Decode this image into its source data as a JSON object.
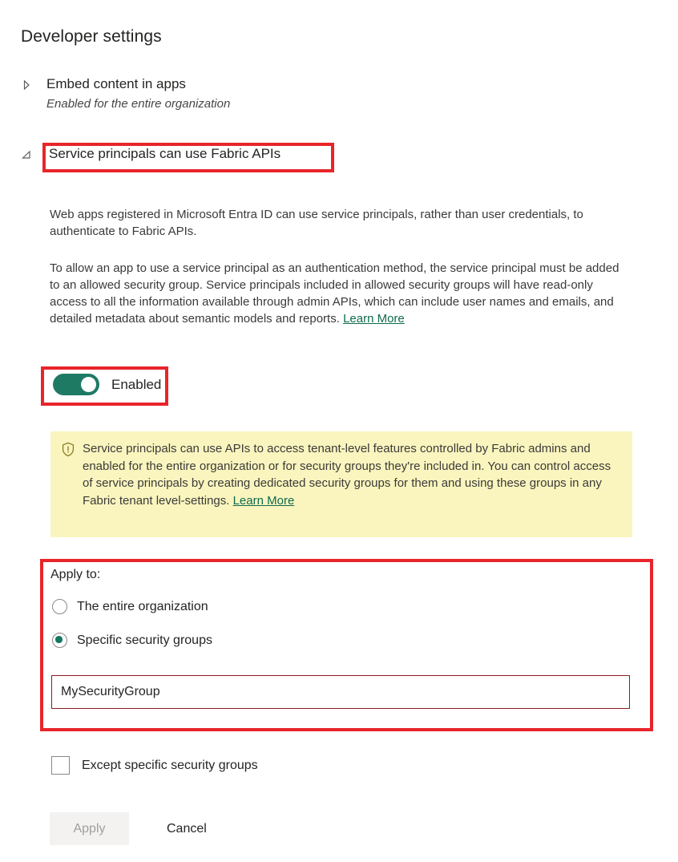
{
  "page": {
    "title": "Developer settings"
  },
  "settings": [
    {
      "title": "Embed content in apps",
      "subtitle": "Enabled for the entire organization",
      "expand_icon": "chevron-right-icon",
      "expanded": false
    },
    {
      "title": "Service principals can use Fabric APIs",
      "expand_icon": "chevron-down-icon",
      "expanded": true
    }
  ],
  "detail": {
    "paragraph_1": "Web apps registered in Microsoft Entra ID can use service principals, rather than user credentials, to authenticate to Fabric APIs.",
    "paragraph_2": "To allow an app to use a service principal as an authentication method, the service principal must be added to an allowed security group. Service principals included in allowed security groups will have read-only access to all the information available through admin APIs, which can include user names and emails, and detailed metadata about semantic models and reports. ",
    "learn_more": "Learn More",
    "toggle": {
      "label": "Enabled",
      "state": "on",
      "color": "#1f7a63"
    },
    "notice": {
      "icon": "shield-warning-icon",
      "background": "#faf5be",
      "text": "Service principals can use APIs to access tenant-level features controlled by Fabric admins and enabled for the entire organization or for security groups they're included in. You can control access of service principals by creating dedicated security groups for them and using these groups in any Fabric tenant level-settings. ",
      "learn_more": "Learn More"
    },
    "apply_to": {
      "label": "Apply to:",
      "options": [
        {
          "label": "The entire organization",
          "selected": false
        },
        {
          "label": "Specific security groups",
          "selected": true
        }
      ],
      "security_group_input": {
        "value": "MySecurityGroup",
        "placeholder": ""
      },
      "except_checkbox": {
        "label": "Except specific security groups",
        "checked": false
      }
    },
    "actions": {
      "apply_label": "Apply",
      "apply_disabled": true,
      "cancel_label": "Cancel"
    }
  },
  "annotations": {
    "color": "#e8252a",
    "boxes": [
      "service-principals-title",
      "enabled-toggle",
      "apply-to-section"
    ]
  }
}
